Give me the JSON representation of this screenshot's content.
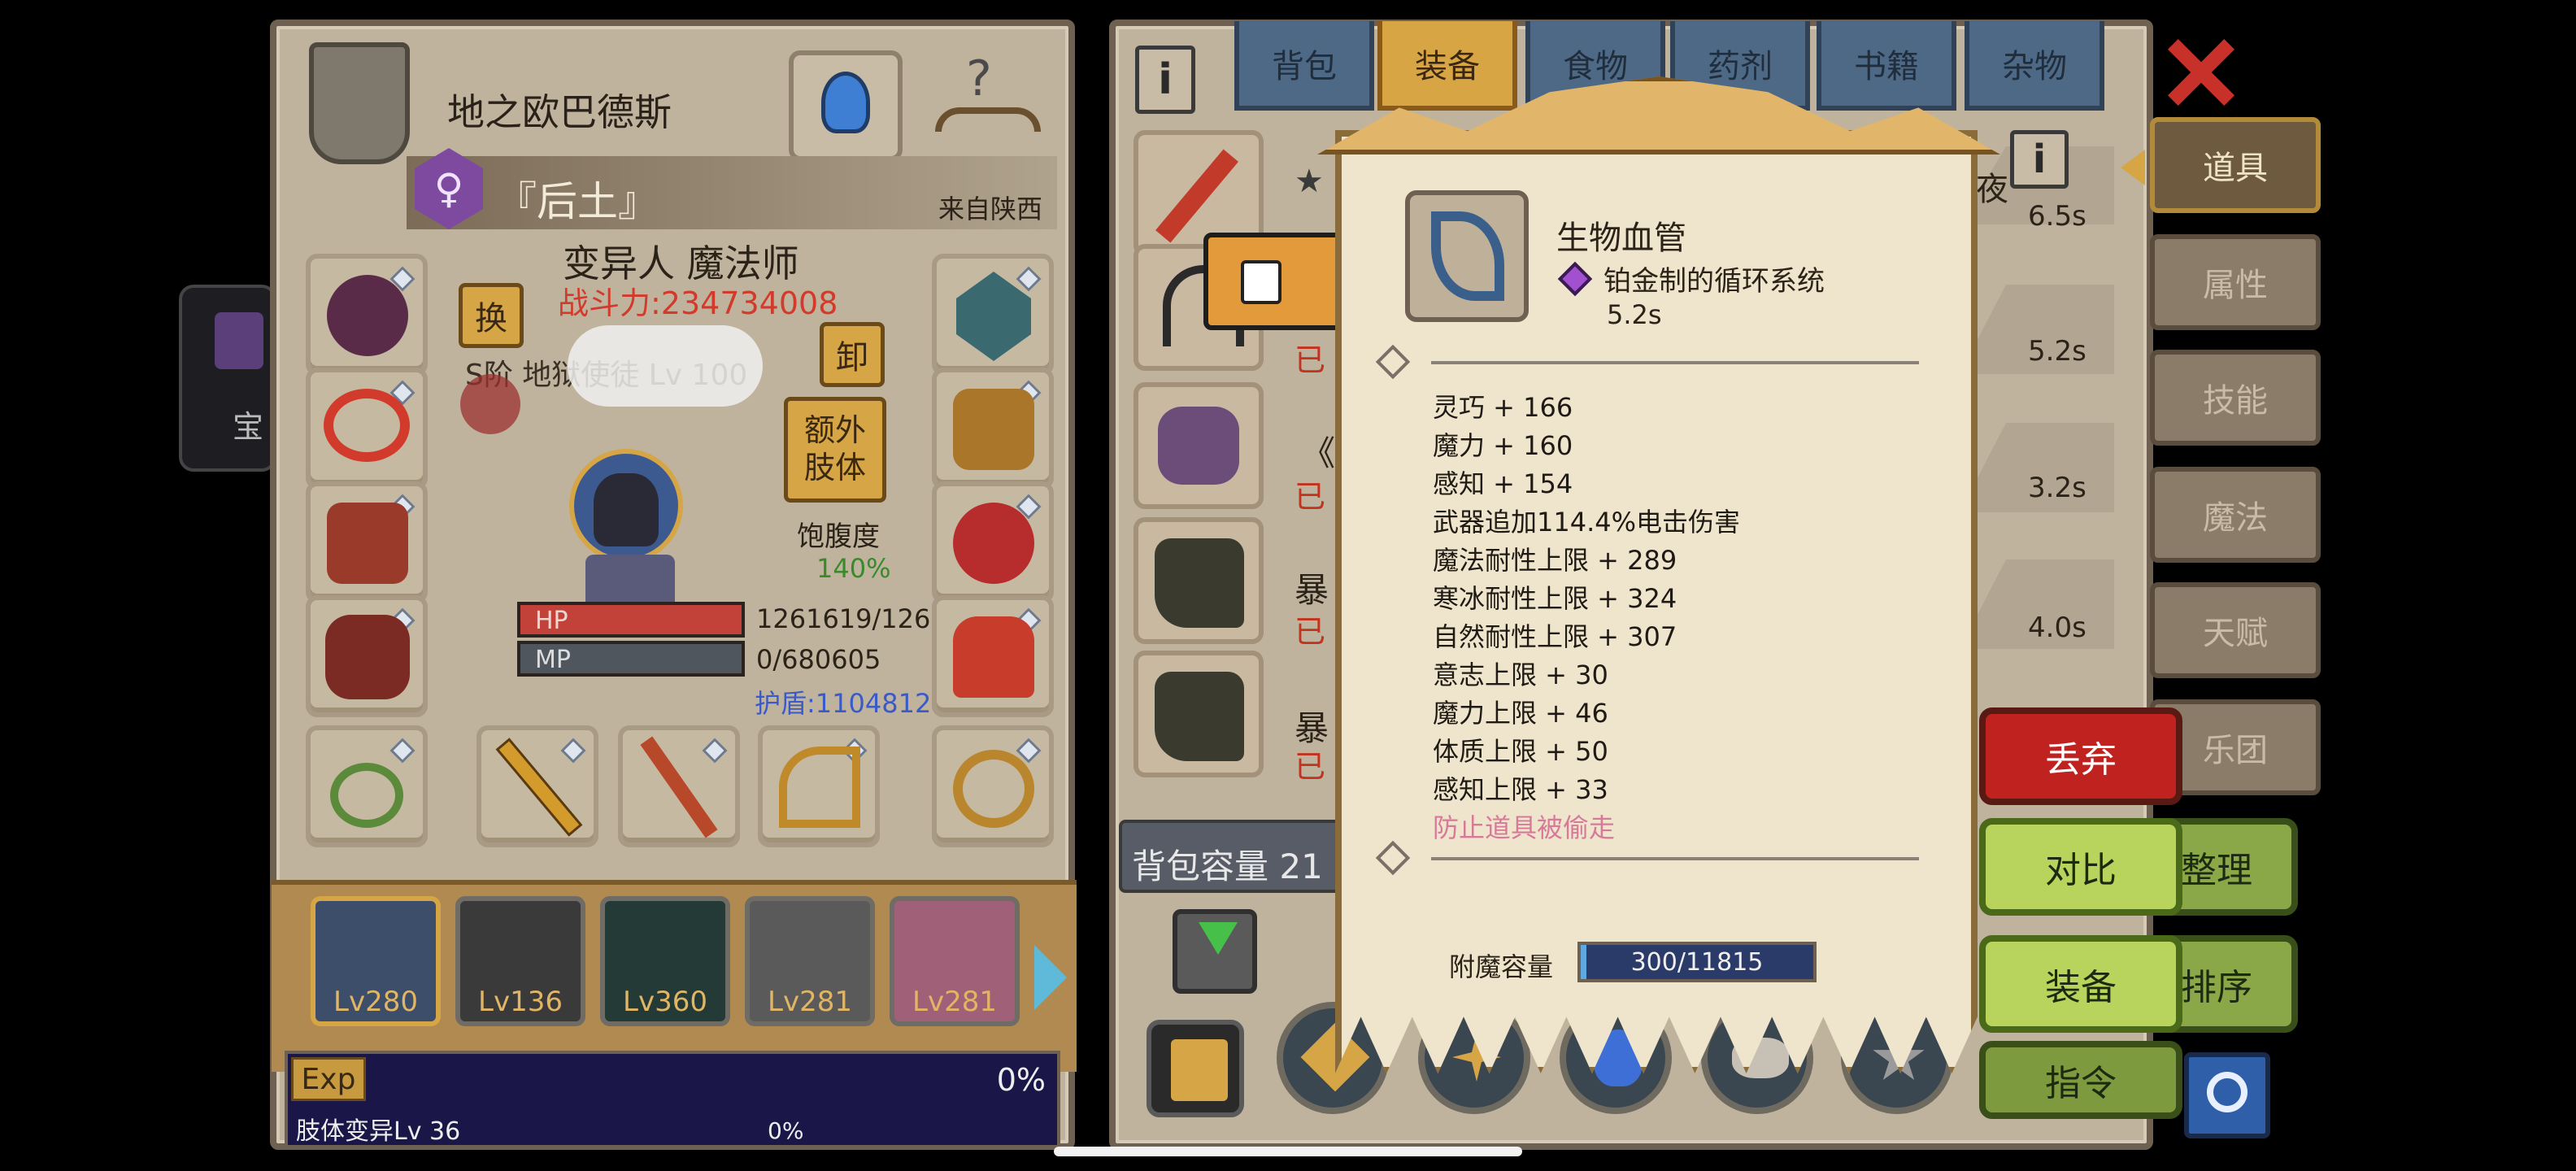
{
  "character": {
    "name": "地之欧巴德斯",
    "title": "『后土』",
    "origin": "来自陕西",
    "class": "变异人 魔法师",
    "power": "战斗力:234734008",
    "weapon_label": "S阶 地狱使徒 Lv 100",
    "swap_label": "换",
    "unequip_label": "卸",
    "extra_limbs_label": "额外肢体",
    "satiety_label": "饱腹度",
    "satiety_value": "140%",
    "hp_label": "HP",
    "hp_value": "1261619/126",
    "mp_label": "MP",
    "mp_value": "0/680605",
    "shield_value": "护盾:1104812",
    "hp_fill": 1.0,
    "mp_fill": 0.0
  },
  "party": [
    {
      "level": "Lv280"
    },
    {
      "level": "Lv136"
    },
    {
      "level": "Lv360"
    },
    {
      "level": "Lv281"
    },
    {
      "level": "Lv281"
    }
  ],
  "exp": {
    "label": "Exp",
    "percent": "0%",
    "mutation_label": "肢体变异Lv 36",
    "mutation_percent": "0%"
  },
  "left_peek": {
    "label": "宝"
  },
  "inventory": {
    "tabs": [
      "背包",
      "装备",
      "食物",
      "药剂",
      "书籍",
      "杂物"
    ],
    "active_tab": "装备",
    "capacity_label": "背包容量 21",
    "equipped_status": "已",
    "items": [
      {
        "text": "★",
        "time": "6.5s"
      },
      {
        "text": "",
        "time": "5.2s"
      },
      {
        "text": "《",
        "time": "3.2s"
      },
      {
        "text": "暴",
        "time": "4.0s"
      },
      {
        "text": "暴",
        "time": ""
      }
    ],
    "night_fragment": "夜"
  },
  "tooltip": {
    "item_name": "生物血管",
    "set_name": "铂金制的循环系统",
    "time": "5.2s",
    "stats": [
      "灵巧 + 166",
      "魔力 + 160",
      "感知 + 154",
      "武器追加114.4%电击伤害",
      "魔法耐性上限 + 289",
      "寒冰耐性上限 + 324",
      "自然耐性上限 + 307",
      "意志上限 + 30",
      "魔力上限 + 46",
      "体质上限 + 50",
      "感知上限 + 33"
    ],
    "special": "防止道具被偷走",
    "enchant_label": "附魔容量",
    "enchant_value": "300/11815",
    "enchant_fill": 0.025
  },
  "side_menu": [
    "道具",
    "属性",
    "技能",
    "魔法",
    "天赋",
    "乐团"
  ],
  "actions": {
    "discard": "丢弃",
    "compare": "对比",
    "equip": "装备",
    "organize": "整理",
    "sort": "排序",
    "command": "指令"
  },
  "colors": {
    "panel": "#bfb39e",
    "active_tab": "#d8a545",
    "discard": "#c0231f",
    "green_button": "#a3c455",
    "power_text": "#d23b2b",
    "shield_text": "#3a5bc7",
    "special_text": "#d77a9a"
  }
}
